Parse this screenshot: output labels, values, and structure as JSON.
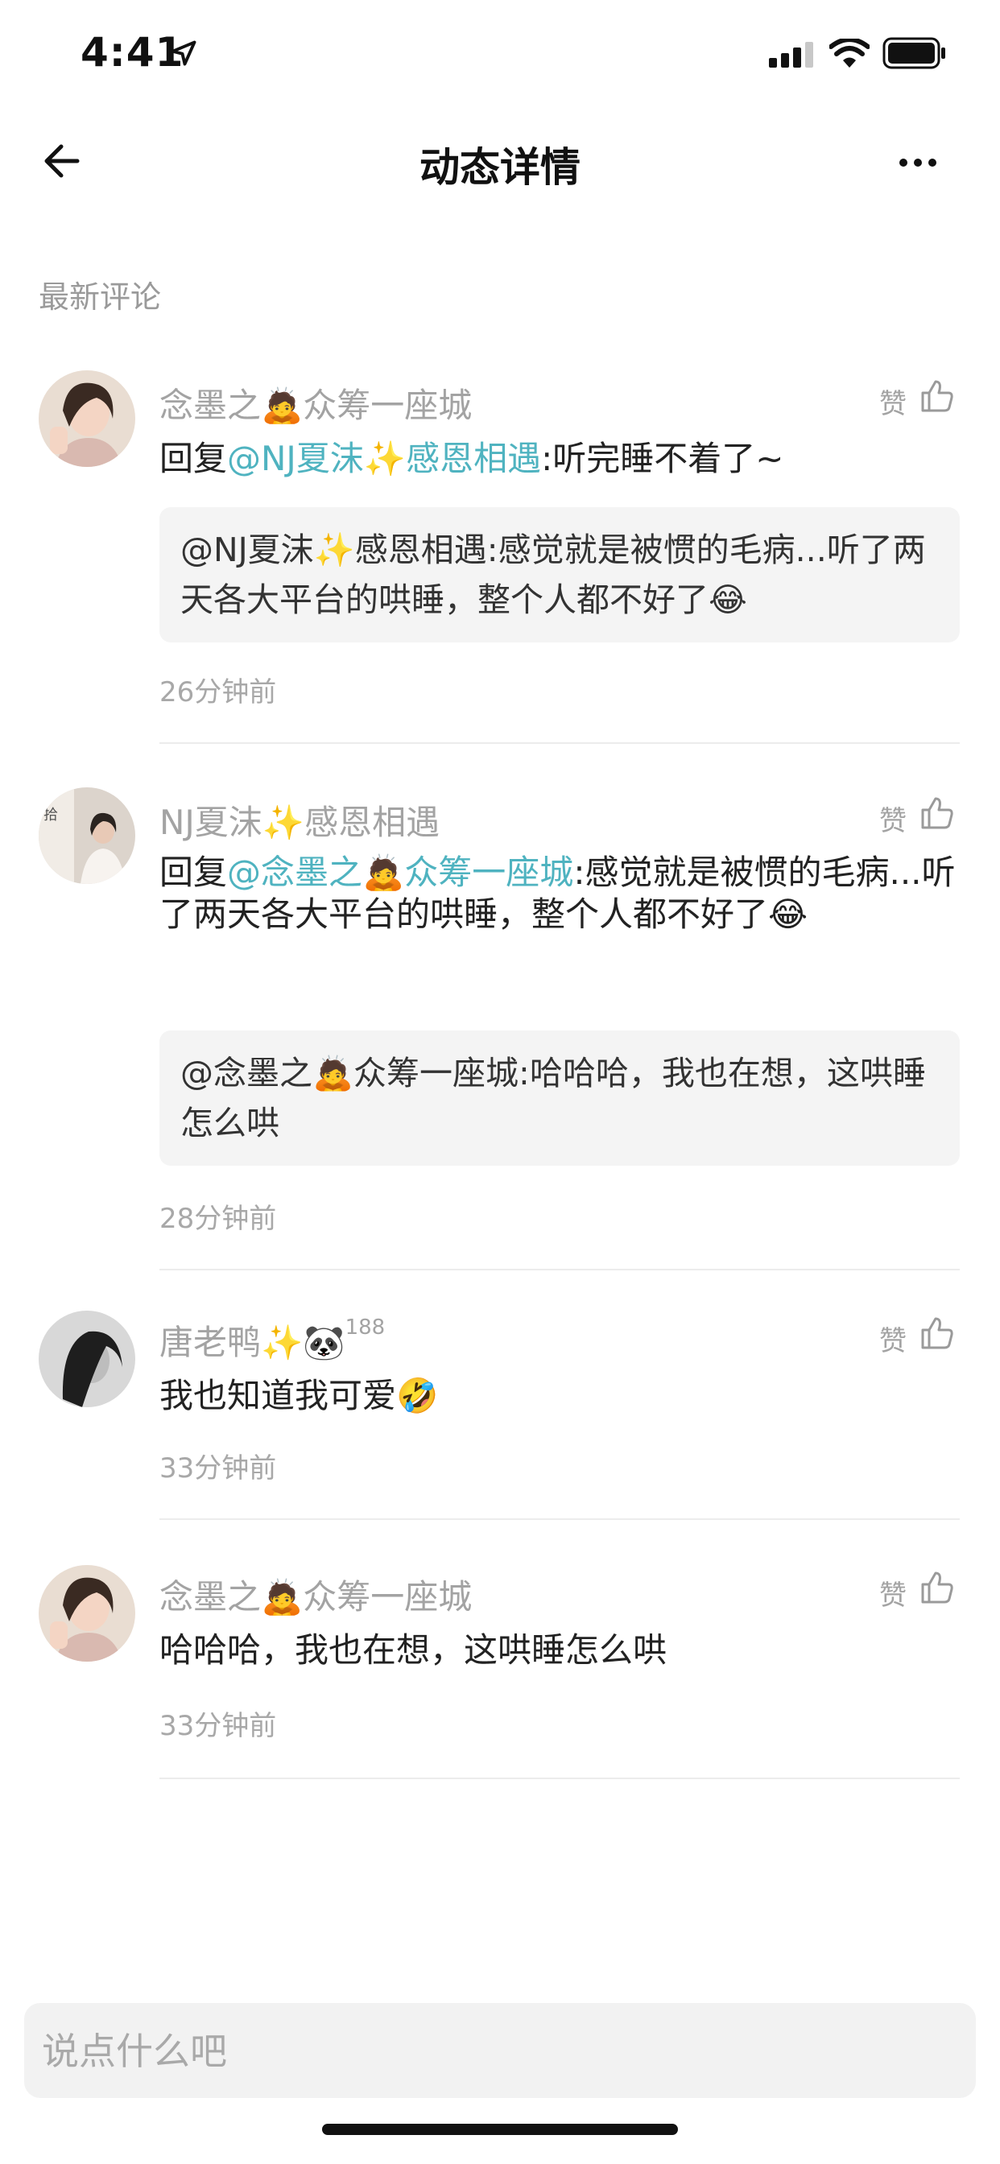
{
  "status_bar": {
    "time": "4:41"
  },
  "nav": {
    "title": "动态详情"
  },
  "section": {
    "label": "最新评论"
  },
  "like_label": "赞",
  "comments": [
    {
      "author": "念墨之🙇众筹一座城",
      "reply_prefix": "回复",
      "reply_to": "@NJ夏沫✨感恩相遇",
      "text": ":听完睡不着了~",
      "quote": "@NJ夏沫✨感恩相遇:感觉就是被惯的毛病...听了两天各大平台的哄睡，整个人都不好了😂",
      "time": "26分钟前"
    },
    {
      "author": "NJ夏沫✨感恩相遇",
      "reply_prefix": "回复",
      "reply_to": "@念墨之🙇众筹一座城",
      "text": ":感觉就是被惯的毛病...听了两天各大平台的哄睡，整个人都不好了😂",
      "quote": "@念墨之🙇众筹一座城:哈哈哈，我也在想，这哄睡怎么哄",
      "time": "28分钟前"
    },
    {
      "author": "唐老鸭✨🐼",
      "author_badge": "188",
      "text": "我也知道我可爱🤣",
      "time": "33分钟前"
    },
    {
      "author": "念墨之🙇众筹一座城",
      "text": "哈哈哈，我也在想，这哄睡怎么哄",
      "time": "33分钟前"
    }
  ],
  "input": {
    "placeholder": "说点什么吧"
  }
}
